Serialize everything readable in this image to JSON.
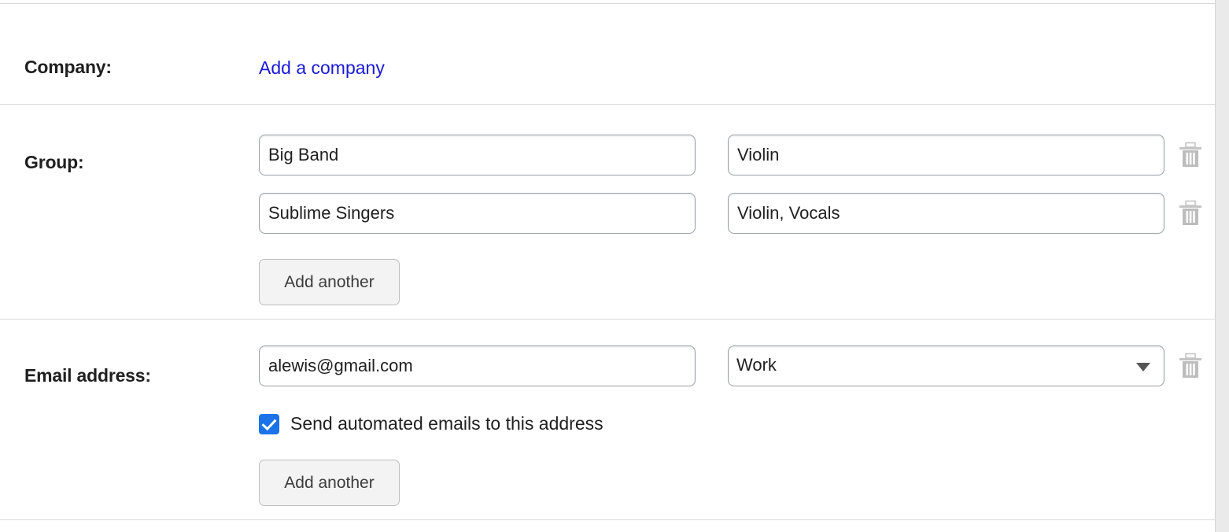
{
  "theme": {
    "link_color": "#1a1ad6",
    "checkbox_color": "#1a73e8",
    "divider_color": "#d9d9d9",
    "field_border_color": "#9aa0a6",
    "button_bg_color": "#f3f3f3",
    "trash_icon_color": "#bdbdbd",
    "text_color": "#1f1f1f"
  },
  "form": {
    "company": {
      "label": "Company:",
      "add_link": "Add a company"
    },
    "group": {
      "label": "Group:",
      "rows": [
        {
          "name_value": "Big Band",
          "role_value": "Violin",
          "delete_icon": "trash-icon"
        },
        {
          "name_value": "Sublime Singers",
          "role_value": "Violin, Vocals",
          "delete_icon": "trash-icon"
        }
      ],
      "add_another_label": "Add another"
    },
    "email": {
      "label": "Email address:",
      "address_value": "alewis@gmail.com",
      "type_value": "Work",
      "type_dropdown_icon": "chevron-down-icon",
      "delete_icon": "trash-icon",
      "checkbox_label": "Send automated emails to this address",
      "checkbox_checked": true,
      "add_another_label": "Add another"
    }
  },
  "scrollbar": {
    "orientation": "vertical"
  }
}
